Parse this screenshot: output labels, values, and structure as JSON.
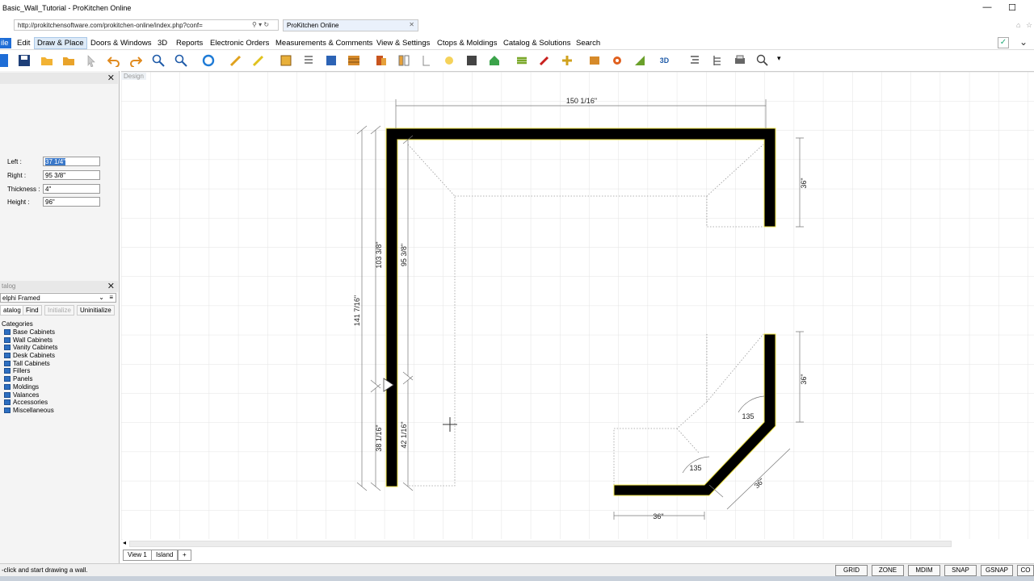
{
  "window": {
    "title": "Basic_Wall_Tutorial - ProKitchen Online",
    "url": "http://prokitchensoftware.com/prokitchen-online/index.php?conf=",
    "browser_tab": "ProKitchen Online",
    "minimize": "—",
    "maximize": "☐"
  },
  "menu": {
    "file": "ile",
    "items": [
      "Edit",
      "Draw & Place",
      "Doors & Windows",
      "3D",
      "Reports",
      "Electronic Orders",
      "Measurements & Comments",
      "View & Settings",
      "Ctops & Moldings",
      "Catalog & Solutions",
      "Search"
    ],
    "active_index": 1
  },
  "properties": {
    "left_label": "Left :",
    "left_value": "37 1/4\"",
    "right_label": "Right :",
    "right_value": "95 3/8\"",
    "thickness_label": "Thickness :",
    "thickness_value": "4\"",
    "height_label": "Height :",
    "height_value": "96\""
  },
  "catalog": {
    "header": "talog",
    "selected": "elphi Framed",
    "tabs": [
      "atalog",
      "Find",
      "Initialize",
      "Uninitialize"
    ],
    "root": "Categories",
    "categories": [
      "Base Cabinets",
      "Wall Cabinets",
      "Vanity Cabinets",
      "Desk Cabinets",
      "Tall Cabinets",
      "Fillers",
      "Panels",
      "Moldings",
      "Valances",
      "Accessories",
      "Miscellaneous"
    ]
  },
  "canvas": {
    "design_tab": "Design",
    "dimensions": {
      "top_overall": "150 1/16\"",
      "right_upper": "36\"",
      "right_lower": "36\"",
      "left_outer": "141 7/16\"",
      "left_upper_outer": "103 3/8\"",
      "left_upper_inner": "95 3/8\"",
      "left_lower_outer": "38 1/16\"",
      "left_lower_inner": "42 1/16\"",
      "angle_upper": "135",
      "angle_lower": "135",
      "diagonal": "36\"",
      "bottom": "36\""
    }
  },
  "view_tabs": [
    "View 1",
    "Island",
    "+"
  ],
  "status": {
    "text": "-click and start drawing a wall.",
    "buttons": [
      "GRID",
      "ZONE",
      "MDIM",
      "SNAP",
      "GSNAP",
      "CO"
    ]
  },
  "colors": {
    "wall": "#000000",
    "wall_edge": "#f2e64a",
    "grid": "#e3e3e3",
    "accent": "#1e6dd6"
  }
}
